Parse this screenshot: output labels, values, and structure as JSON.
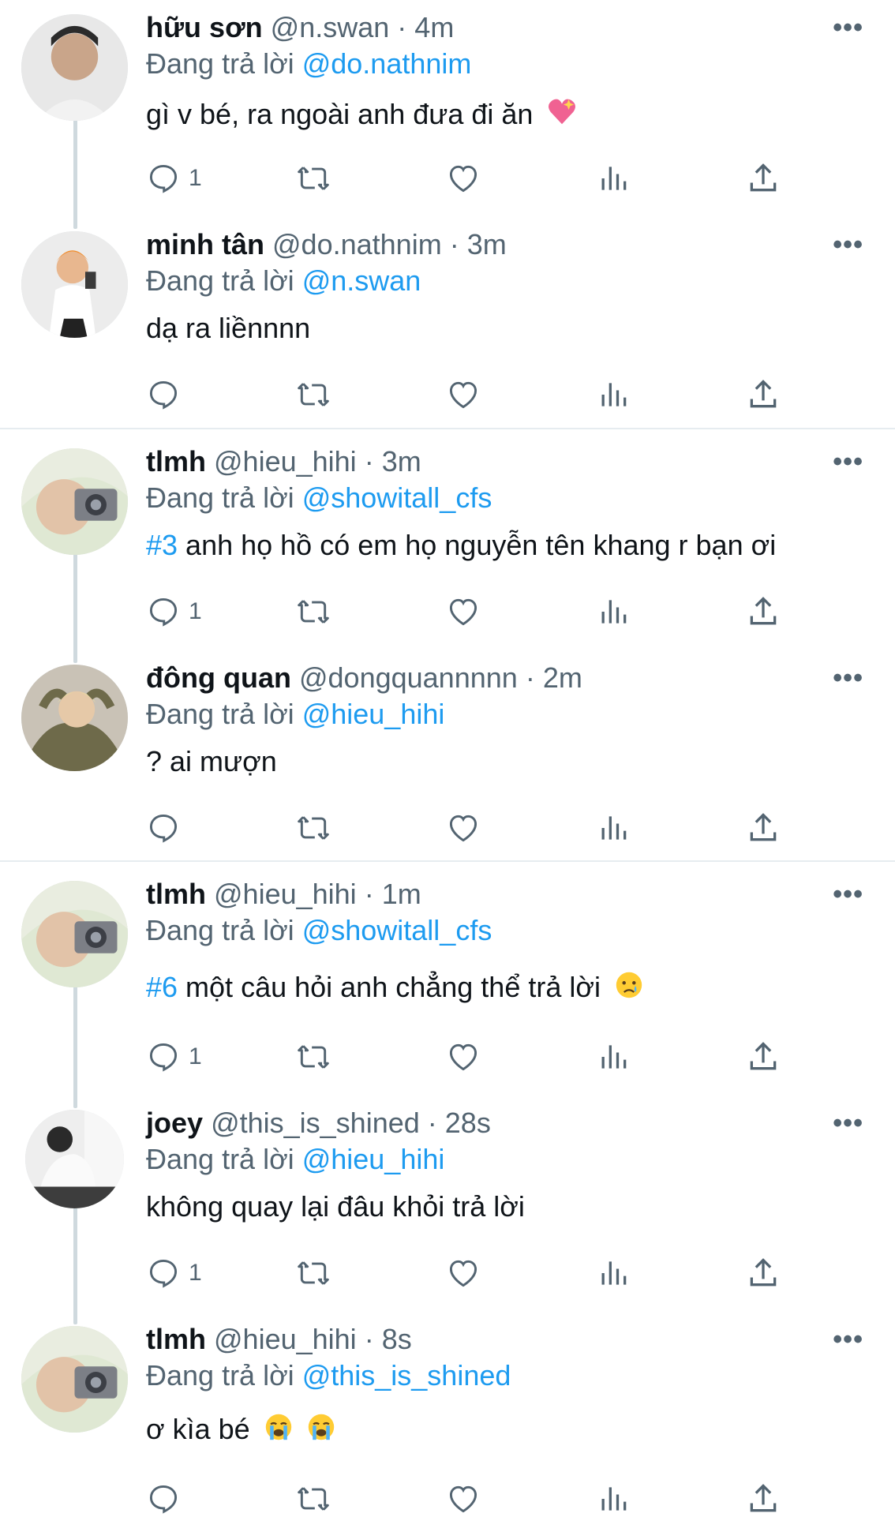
{
  "replying_prefix": "Đang trả lời",
  "tweets": [
    {
      "name": "hữu sơn",
      "handle": "@n.swan",
      "time": "4m",
      "replying_to": "@do.nathnim",
      "hashtag": "",
      "text": "gì v bé, ra ngoài anh đưa đi ăn",
      "emoji": "sparkling-heart",
      "reply_count": "1",
      "avatar": "avatar-huu-son"
    },
    {
      "name": "minh tân",
      "handle": "@do.nathnim",
      "time": "3m",
      "replying_to": "@n.swan",
      "hashtag": "",
      "text": "dạ ra liềnnnn",
      "emoji": "",
      "reply_count": "",
      "avatar": "avatar-minh-tan"
    },
    {
      "name": "tlmh",
      "handle": "@hieu_hihi",
      "time": "3m",
      "replying_to": "@showitall_cfs",
      "hashtag": "#3",
      "text": " anh họ hồ có em họ nguyễn tên khang r bạn ơi",
      "emoji": "",
      "reply_count": "1",
      "avatar": "avatar-tlmh"
    },
    {
      "name": "đông quan",
      "handle": "@dongquannnnn",
      "time": "2m",
      "replying_to": "@hieu_hihi",
      "hashtag": "",
      "text": "? ai mượn",
      "emoji": "",
      "reply_count": "",
      "avatar": "avatar-dong-quan"
    },
    {
      "name": "tlmh",
      "handle": "@hieu_hihi",
      "time": "1m",
      "replying_to": "@showitall_cfs",
      "hashtag": "#6",
      "text": " một câu hỏi anh chẳng thể trả lời",
      "emoji": "crying-face",
      "reply_count": "1",
      "avatar": "avatar-tlmh"
    },
    {
      "name": "joey",
      "handle": "@this_is_shined",
      "time": "28s",
      "replying_to": "@hieu_hihi",
      "hashtag": "",
      "text": "không quay lại đâu khỏi trả lời",
      "emoji": "",
      "reply_count": "1",
      "avatar": "avatar-joey"
    },
    {
      "name": "tlmh",
      "handle": "@hieu_hihi",
      "time": "8s",
      "replying_to": "@this_is_shined",
      "hashtag": "",
      "text": "ơ kìa bé",
      "emoji": "loudly-crying-face-x2",
      "reply_count": "",
      "avatar": "avatar-tlmh"
    }
  ],
  "icons": {
    "reply": "reply-icon",
    "retweet": "retweet-icon",
    "like": "heart-icon",
    "views": "views-icon",
    "share": "share-icon",
    "more": "more-icon"
  },
  "colors": {
    "accent": "#1d9bf0",
    "muted": "#536471",
    "text": "#0f1419",
    "divider": "#e6ecf0"
  }
}
